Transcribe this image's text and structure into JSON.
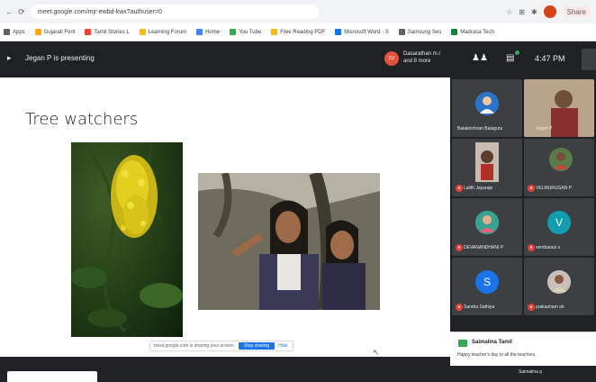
{
  "browser": {
    "url": "meet.google.com/mjr-ewbd-kwx?authuser=0",
    "bookmarks": [
      {
        "label": "Gujarati Font",
        "color": "#f9ab00"
      },
      {
        "label": "Tamil Stories L",
        "color": "#ea4335"
      },
      {
        "label": "Learning Forum",
        "color": "#fbbc04"
      },
      {
        "label": "Home",
        "color": "#4285f4"
      },
      {
        "label": "You Tube",
        "color": "#34a853"
      },
      {
        "label": "Free Reading PDF",
        "color": "#fbbc04"
      },
      {
        "label": "Microsoft Word - S",
        "color": "#1a73e8"
      },
      {
        "label": "Samsung Ses",
        "color": "#5f6368"
      },
      {
        "label": "Madrasa Tech",
        "color": "#188038"
      }
    ],
    "share_pill": "Share"
  },
  "meet": {
    "presenting_text": "Jegan P is presenting",
    "top_presenters": {
      "avatar_initials": "DJ",
      "names_text": "Dasarathan m.r and 8 more"
    },
    "time": "4:47 PM",
    "participant_count_icon": "people-icon",
    "chat_icon": "chat-icon"
  },
  "slide": {
    "title": "Tree watchers",
    "toolbar_text": "meet.google.com is sharing your screen.",
    "stop_label": "Stop sharing",
    "hide_label": "Hide"
  },
  "participants": [
    {
      "name": "Balakrishnan Balaguru",
      "avatar": "photo",
      "color": "#4a6fa5",
      "muted": false
    },
    {
      "name": "Jegan P",
      "avatar": "photo",
      "color": "#a88c6d",
      "muted": false
    },
    {
      "name": "Lalith Jayaraje",
      "avatar": "photo",
      "color": "#8a7a6a",
      "muted": true
    },
    {
      "name": "VELMURUGAN P",
      "avatar": "photo",
      "color": "#5a7a4a",
      "muted": true
    },
    {
      "name": "DEVANANDHANI P",
      "avatar": "photo",
      "color": "#4a9a8a",
      "muted": true
    },
    {
      "name": "vembarasi s",
      "avatar": "V",
      "color": "#129eaf",
      "muted": true
    },
    {
      "name": "Sandra Sathiya",
      "avatar": "S",
      "color": "#1a73e8",
      "muted": true
    },
    {
      "name": "prakasham ah",
      "avatar": "photo",
      "color": "#9a8a7a",
      "muted": true
    }
  ],
  "chat": {
    "sender": "Saimalina Tamil",
    "message": "Happy teacher's day to all the teachers"
  },
  "bottom": {
    "name": "Saimalina p"
  }
}
